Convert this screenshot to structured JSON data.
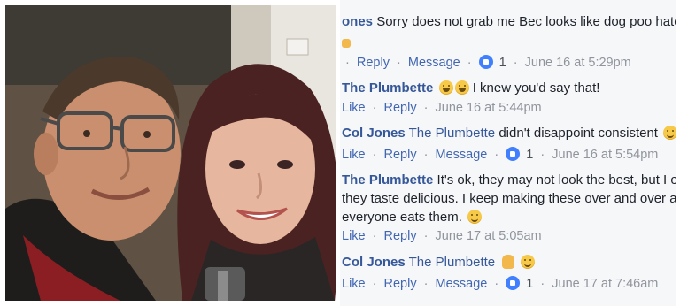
{
  "comments": [
    {
      "line": "ones Sorry does not grab me Bec looks like dog poo hate",
      "author": "ones",
      "text": "Sorry does not grab me Bec looks like dog poo hate",
      "actions": [
        "Reply",
        "Message"
      ],
      "reactions": "1",
      "time": "June 16 at 5:29pm"
    },
    {
      "author": "The Plumbette",
      "text": "I knew you'd say that!",
      "actions": [
        "Like",
        "Reply"
      ],
      "time": "June 16 at 5:44pm"
    },
    {
      "author": "Col Jones",
      "tag": "The Plumbette",
      "text": "didn't disappoint consistent",
      "actions": [
        "Like",
        "Reply",
        "Message"
      ],
      "reactions": "1",
      "time": "June 16 at 5:54pm"
    },
    {
      "author": "The Plumbette",
      "lines": [
        "It's ok, they may not look the best, but I c",
        "they taste delicious. I keep making these over and over a",
        "everyone eats them."
      ],
      "actions": [
        "Like",
        "Reply"
      ],
      "time": "June 17 at 5:05am"
    },
    {
      "author": "Col Jones",
      "tag": "The Plumbette",
      "actions": [
        "Like",
        "Reply",
        "Message"
      ],
      "reactions": "1",
      "time": "June 17 at 7:46am"
    }
  ],
  "separator": "·",
  "icons": {
    "like": "like-badge-icon",
    "smile": "smile-emoji-icon",
    "laugh": "laugh-emoji-icon",
    "ok_hand": "ok-hand-emoji-icon"
  },
  "colors": {
    "name": "#365899",
    "link": "#4267b2",
    "time": "#90949c",
    "like_badge": "#4080ff",
    "panel_bg": "#f6f7f9"
  }
}
